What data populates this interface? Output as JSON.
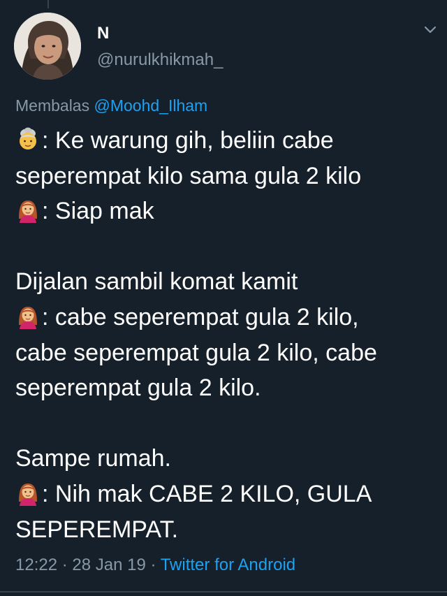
{
  "tweet": {
    "author": {
      "name": "N",
      "handle": "@nurulkhikmah_"
    },
    "reply_prefix": "Membalas",
    "reply_to": "@Moohd_Ilham",
    "lines": [
      {
        "emoji": "old-woman-emoji",
        "text": ": Ke warung gih, beliin cabe"
      },
      {
        "text": "seperempat kilo sama gula 2 kilo"
      },
      {
        "emoji": "woman-emoji",
        "text": ": Siap mak"
      },
      {
        "blank": true
      },
      {
        "text": "Dijalan sambil komat kamit"
      },
      {
        "emoji": "woman-emoji",
        "text": ": cabe seperempat gula 2 kilo,"
      },
      {
        "text": "cabe seperempat gula 2 kilo, cabe"
      },
      {
        "text": "seperempat gula 2 kilo."
      },
      {
        "blank": true
      },
      {
        "text": "Sampe rumah."
      },
      {
        "emoji": "woman-emoji",
        "text": ": Nih mak CABE 2 KILO, GULA"
      },
      {
        "text": "SEPEREMPAT."
      }
    ],
    "time": "12:22",
    "separator1": " · ",
    "date": "28 Jan 19",
    "separator2": " · ",
    "source": "Twitter for Android"
  },
  "colors": {
    "background": "#15202b",
    "text_primary": "#ffffff",
    "text_secondary": "#8899a6",
    "accent": "#1da1f2",
    "divider": "#38444d"
  }
}
